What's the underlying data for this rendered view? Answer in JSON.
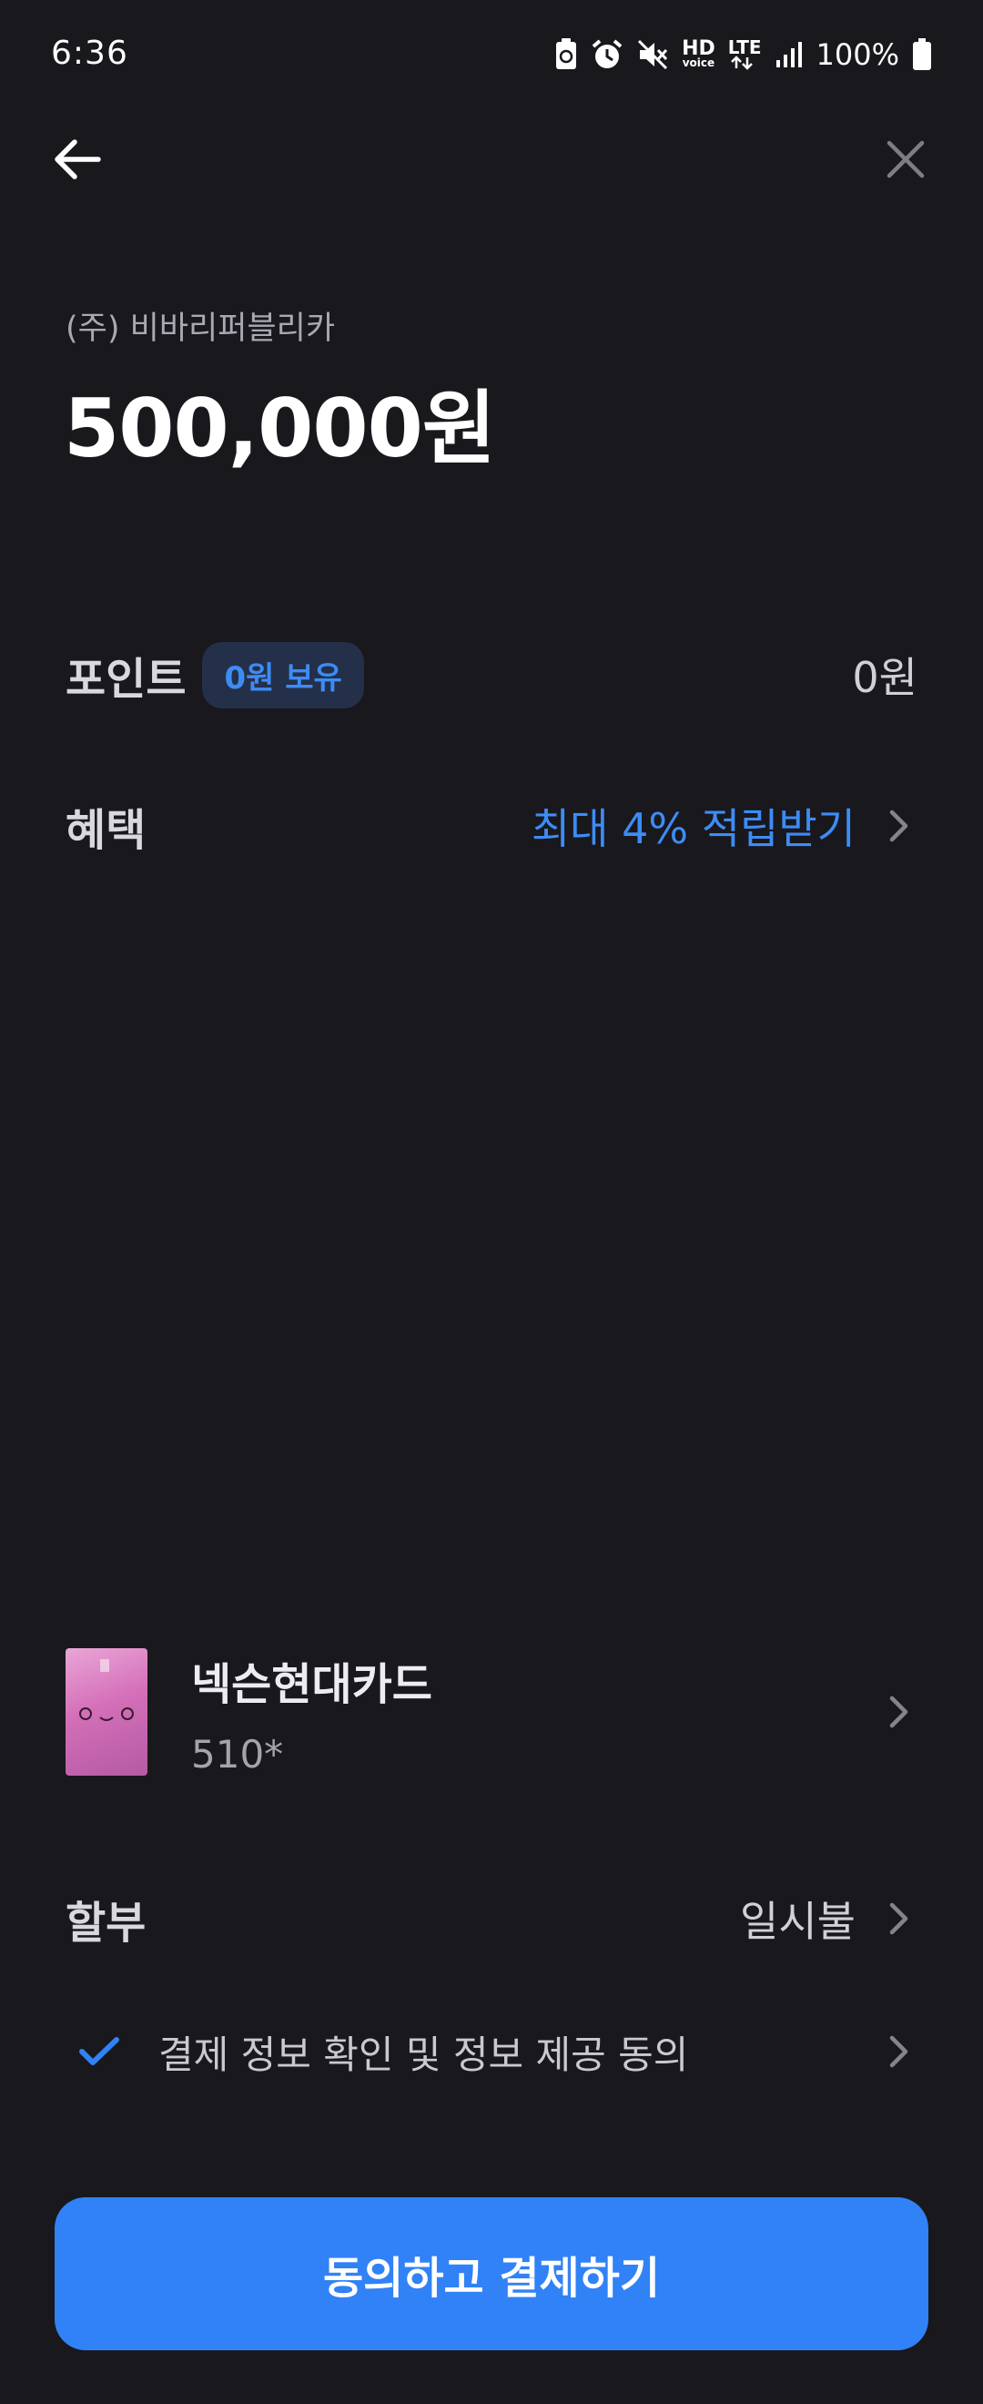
{
  "status_bar": {
    "time": "6:36",
    "hd_top": "HD",
    "hd_bottom": "voice",
    "lte": "LTE",
    "battery": "100%"
  },
  "icons": {
    "back": "arrow-left-icon",
    "close": "close-icon",
    "chevron": "chevron-right-icon",
    "check": "checkmark-icon"
  },
  "payment": {
    "merchant": "(주) 비바리퍼블리카",
    "amount": "500,000원"
  },
  "points": {
    "label": "포인트",
    "badge": "0원 보유",
    "value": "0원"
  },
  "benefit": {
    "label": "혜택",
    "value": "최대 4% 적립받기"
  },
  "card": {
    "name": "넥슨현대카드",
    "number": "510*"
  },
  "installment": {
    "label": "할부",
    "value": "일시불"
  },
  "agreement": {
    "label": "결제 정보 확인 및 정보 제공 동의",
    "checked": true
  },
  "cta": {
    "label": "동의하고 결제하기"
  },
  "colors": {
    "background": "#18181d",
    "accent": "#3182f6",
    "accent_text": "#3d8cf5",
    "badge_bg": "#243049"
  }
}
